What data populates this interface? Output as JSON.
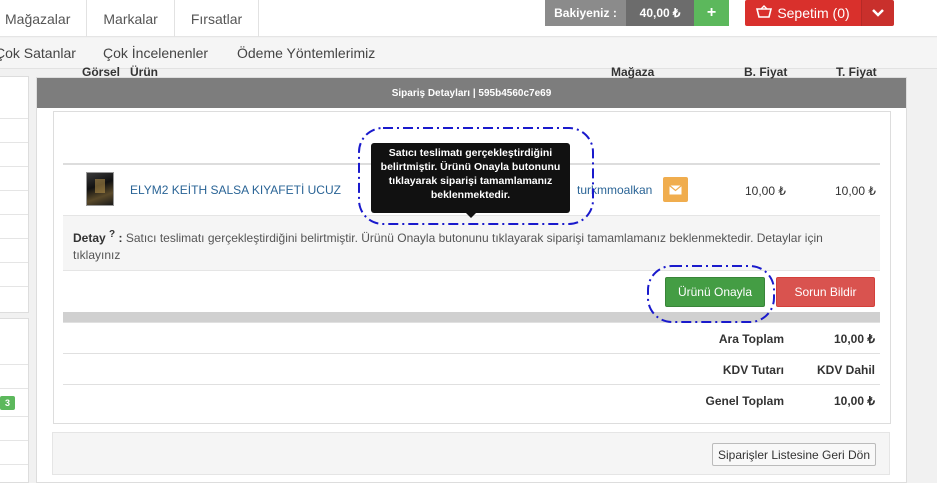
{
  "topnav": {
    "items": [
      "Mağazalar",
      "Markalar",
      "Fırsatlar"
    ],
    "balance_label": "Bakiyeniz :",
    "balance_value": "40,00",
    "currency": "₺",
    "add_label": "+",
    "cart_label": "Sepetim (0)"
  },
  "subnav": {
    "items": [
      "Çok Satanlar",
      "Çok İncelenenler",
      "Ödeme Yöntemlerimiz"
    ]
  },
  "sidebar": {
    "badge": "3"
  },
  "panel": {
    "title": "Sipariş Detayları | 595b4560c7e69"
  },
  "table": {
    "headers": [
      "Görsel",
      "Ürün",
      "Mağaza",
      "B. Fiyat",
      "T. Fiyat"
    ],
    "row": {
      "product": "ELYM2 KEİTH SALSA KIYAFETİ UCUZ",
      "store": "turkmmoalkan",
      "unit_price": "10,00 ₺",
      "total_price": "10,00 ₺"
    }
  },
  "tooltip": {
    "text": "Satıcı teslimatı gerçekleştirdiğini belirtmiştir. Ürünü Onayla butonunu tıklayarak siparişi tamamlamanız beklenmektedir."
  },
  "detail": {
    "label": "Detay",
    "help": "?",
    "text": "Satıcı teslimatı gerçekleştirdiğini belirtmiştir. Ürünü Onayla butonunu tıklayarak siparişi tamamlamanız beklenmektedir. Detaylar için tıklayınız"
  },
  "actions": {
    "confirm": "Ürünü Onayla",
    "report": "Sorun Bildir"
  },
  "summary": [
    {
      "label": "Ara Toplam",
      "value": "10,00 ₺"
    },
    {
      "label": "KDV Tutarı",
      "value": "KDV Dahil"
    },
    {
      "label": "Genel Toplam",
      "value": "10,00 ₺"
    }
  ],
  "footer": {
    "back": "Siparişler Listesine Geri Dön"
  },
  "colors": {
    "confirm": "#449d44",
    "report": "#d9534f",
    "cart": "#d9302c",
    "highlight": "#1a1acc"
  },
  "icons": [
    "cart-icon",
    "chevron-down-icon",
    "envelope-icon"
  ]
}
